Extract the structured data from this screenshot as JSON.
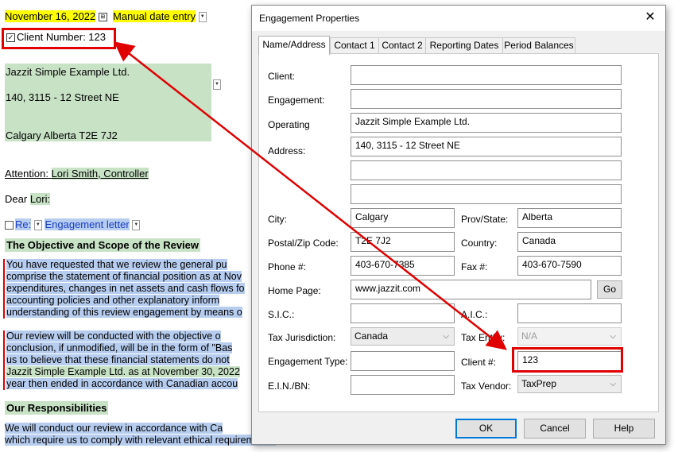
{
  "document": {
    "date": "November 16, 2022",
    "date_mode": "Manual date entry",
    "client_number_line": "Client Number: 123",
    "address_lines": [
      "Jazzit Simple Example Ltd.",
      "140, 3115 - 12 Street NE",
      "Calgary Alberta  T2E 7J2"
    ],
    "attention_label": "Attention:",
    "attention_name": "Lori Smith, Controller",
    "dear_label": "Dear",
    "dear_name": "Lori:",
    "re_label": "Re:",
    "re_value": "Engagement letter",
    "heading_objective": "The Objective and Scope of the Review",
    "para1": [
      "You have requested that we review the general pu",
      "comprise the statement of financial position as at Nov",
      "expenditures, changes in net assets and cash flows fo",
      "accounting policies and other explanatory inform",
      "understanding of this review engagement by means o"
    ],
    "para2": [
      "Our review will be conducted with the objective o",
      "conclusion, if unmodified, will be in the form of \"Bas",
      "us to believe that these financial statements do not",
      "Jazzit Simple Example Ltd.  as at  November 30, 2022",
      "year then ended in accordance with Canadian accou"
    ],
    "heading_responsibilities": "Our Responsibilities",
    "para3": [
      "We will conduct our review in accordance with Ca",
      "which require us to comply with relevant ethical requirements."
    ]
  },
  "dialog": {
    "title": "Engagement Properties",
    "close": "✕",
    "tabs": [
      "Name/Address",
      "Contact 1",
      "Contact 2",
      "Reporting Dates",
      "Period Balances"
    ],
    "labels": {
      "client": "Client:",
      "engagement": "Engagement:",
      "operating": "Operating",
      "address": "Address:",
      "city": "City:",
      "prov": "Prov/State:",
      "postal": "Postal/Zip Code:",
      "country": "Country:",
      "phone": "Phone #:",
      "fax": "Fax #:",
      "homepage": "Home Page:",
      "sic": "S.I.C.:",
      "aic": "A.I.C.:",
      "taxjur": "Tax Jurisdiction:",
      "taxentity": "Tax Entity:",
      "engtype": "Engagement Type:",
      "clientno": "Client #:",
      "ein": "E.I.N./BN:",
      "taxvendor": "Tax Vendor:"
    },
    "values": {
      "client": "",
      "engagement": "",
      "operating": "Jazzit Simple Example Ltd.",
      "address1": "140, 3115 - 12 Street NE",
      "address2": "",
      "address3": "",
      "city": "Calgary",
      "prov": "Alberta",
      "postal": "T2E 7J2",
      "country": "Canada",
      "phone": "403-670-7385",
      "fax": "403-670-7590",
      "homepage": "www.jazzit.com",
      "sic": "",
      "aic": "",
      "taxjur": "Canada",
      "taxentity": "N/A",
      "engtype": "",
      "clientno": "123",
      "ein": "",
      "taxvendor": "TaxPrep"
    },
    "buttons": {
      "go": "Go",
      "ok": "OK",
      "cancel": "Cancel",
      "help": "Help"
    }
  },
  "colors": {
    "highlight_red": "#e00000",
    "date_yellow": "#ffff00",
    "field_green": "#c7e2c5",
    "selection_blue": "#b6cdef"
  }
}
